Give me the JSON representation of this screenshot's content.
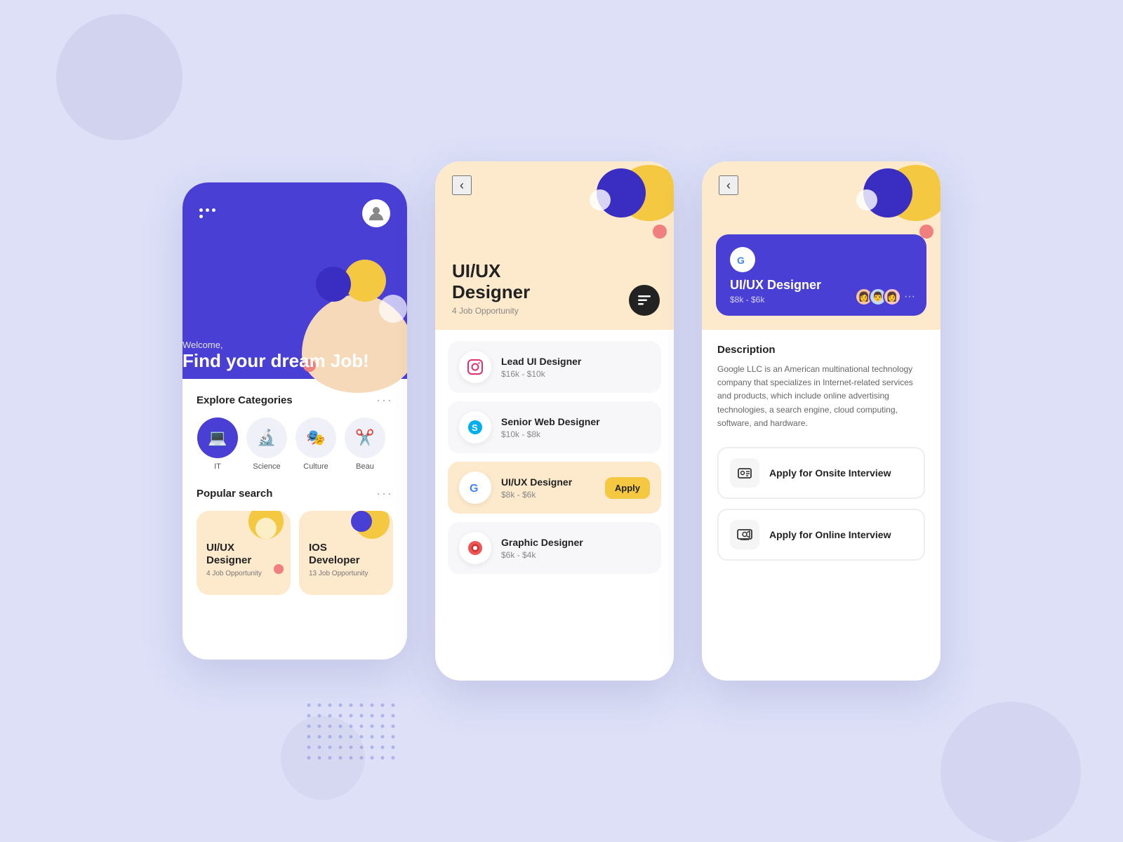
{
  "background": {
    "color": "#dde0f7"
  },
  "phone1": {
    "header": {
      "greeting": "Welcome,",
      "tagline": "Find your dream Job!"
    },
    "categories": {
      "title": "Explore Categories",
      "more": "···",
      "items": [
        {
          "label": "IT",
          "icon": "💻",
          "active": true
        },
        {
          "label": "Science",
          "icon": "🔬",
          "active": false
        },
        {
          "label": "Culture",
          "icon": "🎭",
          "active": false
        },
        {
          "label": "Beau",
          "icon": "✂️",
          "active": false
        }
      ]
    },
    "popular": {
      "title": "Popular search",
      "more": "···",
      "cards": [
        {
          "title": "UI/UX Designer",
          "sub": "4 Job Opportunity"
        },
        {
          "title": "IOS Developer",
          "sub": "13 Job Opportunity"
        }
      ]
    }
  },
  "phone2": {
    "header": {
      "back": "‹",
      "title": "UI/UX Designer",
      "subtitle": "4 Job Opportunity",
      "filter_icon": "≡"
    },
    "jobs": [
      {
        "name": "Lead UI Designer",
        "salary": "$16k - $10k",
        "logo": "📷",
        "highlighted": false
      },
      {
        "name": "Senior Web Designer",
        "salary": "$10k - $8k",
        "logo": "💬",
        "highlighted": false
      },
      {
        "name": "UI/UX Designer",
        "salary": "$8k - $6k",
        "logo": "G",
        "highlighted": true,
        "apply": "Apply"
      },
      {
        "name": "Graphic Designer",
        "salary": "$6k - $4k",
        "logo": "🎨",
        "highlighted": false
      }
    ]
  },
  "phone3": {
    "header": {
      "back": "‹",
      "job_title": "UI/UX Designer",
      "salary": "$8k - $6k",
      "company_logo": "G"
    },
    "description": {
      "title": "Description",
      "text": "Google LLC is an American multinational technology company that specializes in Internet-related services and products, which include online advertising technologies, a search engine, cloud computing, software, and hardware."
    },
    "buttons": [
      {
        "label": "Apply for Onsite Interview",
        "icon": "🏢"
      },
      {
        "label": "Apply for Online Interview",
        "icon": "🖥️"
      }
    ]
  }
}
